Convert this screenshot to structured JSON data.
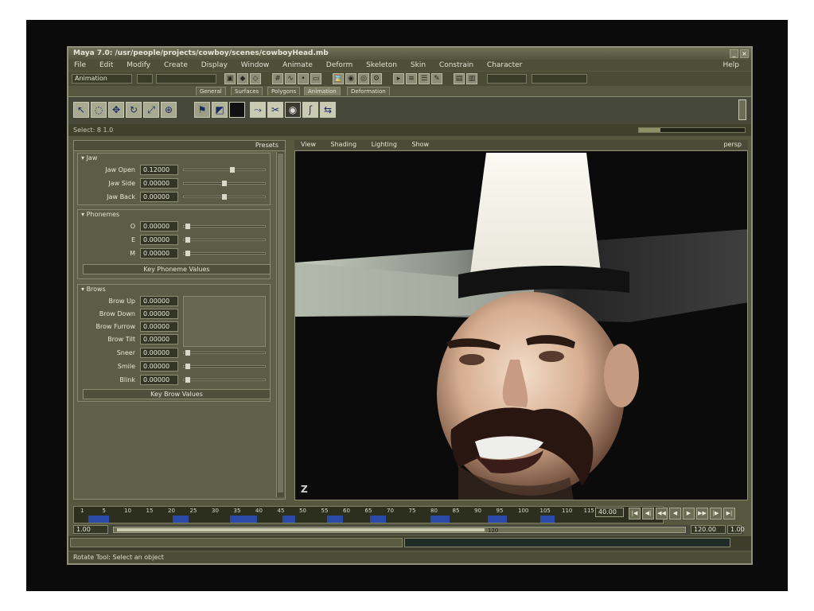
{
  "window": {
    "title": "Maya 7.0: /usr/people/projects/cowboy/scenes/cowboyHead.mb"
  },
  "menu": [
    "File",
    "Edit",
    "Modify",
    "Create",
    "Display",
    "Window",
    "Animate",
    "Deform",
    "Skeleton",
    "Skin",
    "Constrain",
    "Character",
    "Help"
  ],
  "statusline": {
    "mode_dropdown": "Animation"
  },
  "shelf": {
    "tabs": [
      "General",
      "Surfaces",
      "Polygons",
      "Animation",
      "Deformation"
    ],
    "active_tab": "Animation"
  },
  "left_panel": {
    "title": "Presets",
    "sections": [
      {
        "title": "Jaw",
        "rows": [
          {
            "label": "Jaw Open",
            "value": "0.12000",
            "slider": 0.6
          },
          {
            "label": "Jaw Side",
            "value": "0.00000",
            "slider": 0.5
          },
          {
            "label": "Jaw Back",
            "value": "0.00000",
            "slider": 0.5
          }
        ]
      },
      {
        "title": "Phonemes",
        "rows": [
          {
            "label": "O",
            "value": "0.00000",
            "slider": 0.02
          },
          {
            "label": "E",
            "value": "0.00000",
            "slider": 0.02
          },
          {
            "label": "M",
            "value": "0.00000",
            "slider": 0.02
          }
        ],
        "button": "Key Phoneme Values"
      },
      {
        "title": "Brows",
        "rows": [
          {
            "label": "Brow Up",
            "value": "0.00000",
            "slider": null
          },
          {
            "label": "Brow Down",
            "value": "0.00000",
            "slider": null
          },
          {
            "label": "Brow Furrow",
            "value": "0.00000",
            "slider": null
          },
          {
            "label": "Brow Tilt",
            "value": "0.00000",
            "slider": null
          },
          {
            "label": "Sneer",
            "value": "0.00000",
            "slider": 0.02
          },
          {
            "label": "Smile",
            "value": "0.00000",
            "slider": 0.02
          },
          {
            "label": "Blink",
            "value": "0.00000",
            "slider": 0.02
          }
        ],
        "button": "Key Brow Values"
      }
    ]
  },
  "viewport": {
    "menu": [
      "View",
      "Shading",
      "Lighting",
      "Show"
    ],
    "name": "persp",
    "axis_label": "Z"
  },
  "timeline": {
    "frame_labels": [
      "1",
      "5",
      "10",
      "15",
      "20",
      "25",
      "30",
      "35",
      "40",
      "45",
      "50",
      "55",
      "60",
      "65",
      "70",
      "75",
      "80",
      "85",
      "90",
      "95",
      "100",
      "105",
      "110",
      "115"
    ],
    "current_frame": "40.00",
    "range_start": "1.00",
    "range_end": "120.00",
    "range_inner": "1.00",
    "range_current": "120"
  },
  "playback_buttons": [
    "go-to-start",
    "step-back-key",
    "step-back",
    "play-back",
    "play-forward",
    "step-forward",
    "step-forward-key",
    "go-to-end"
  ],
  "help_line": "Rotate Tool: Select an object",
  "info_line": "Select: 8   1.0"
}
